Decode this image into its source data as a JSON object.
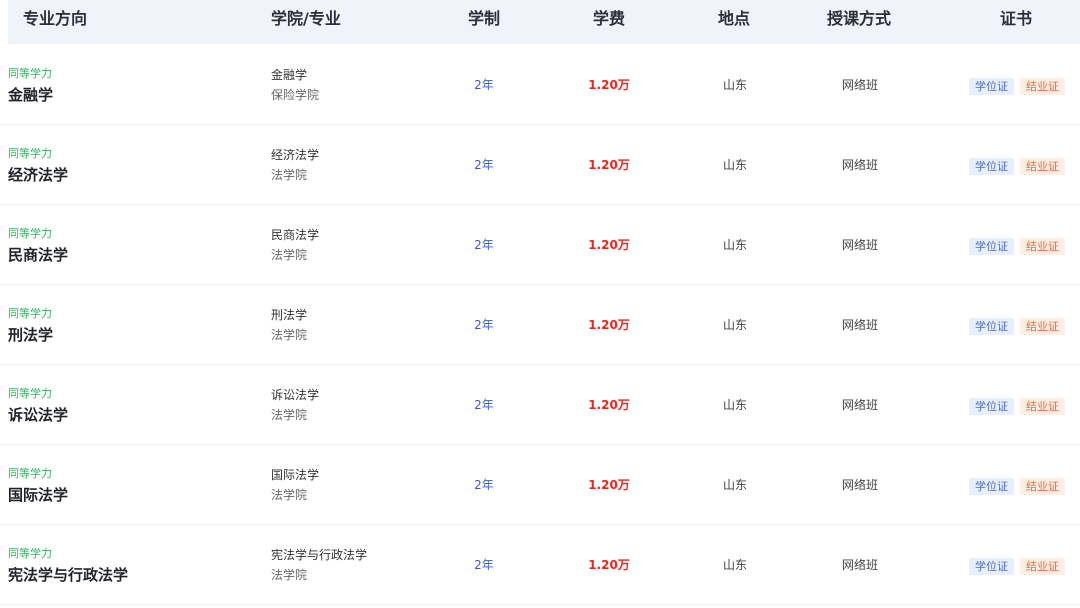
{
  "header": {
    "col_direction": "专业方向",
    "col_college": "学院/专业",
    "col_duration": "学制",
    "col_fee": "学费",
    "col_location": "地点",
    "col_mode": "授课方式",
    "col_certificate": "证书"
  },
  "rows": [
    {
      "type": "同等学力",
      "name": "金融学",
      "sub_major": "金融学",
      "college": "保险学院",
      "duration": "2年",
      "fee": "1.20万",
      "location": "山东",
      "mode": "网络班",
      "cert_degree": "学位证",
      "cert_grad": "结业证"
    },
    {
      "type": "同等学力",
      "name": "经济法学",
      "sub_major": "经济法学",
      "college": "法学院",
      "duration": "2年",
      "fee": "1.20万",
      "location": "山东",
      "mode": "网络班",
      "cert_degree": "学位证",
      "cert_grad": "结业证"
    },
    {
      "type": "同等学力",
      "name": "民商法学",
      "sub_major": "民商法学",
      "college": "法学院",
      "duration": "2年",
      "fee": "1.20万",
      "location": "山东",
      "mode": "网络班",
      "cert_degree": "学位证",
      "cert_grad": "结业证"
    },
    {
      "type": "同等学力",
      "name": "刑法学",
      "sub_major": "刑法学",
      "college": "法学院",
      "duration": "2年",
      "fee": "1.20万",
      "location": "山东",
      "mode": "网络班",
      "cert_degree": "学位证",
      "cert_grad": "结业证"
    },
    {
      "type": "同等学力",
      "name": "诉讼法学",
      "sub_major": "诉讼法学",
      "college": "法学院",
      "duration": "2年",
      "fee": "1.20万",
      "location": "山东",
      "mode": "网络班",
      "cert_degree": "学位证",
      "cert_grad": "结业证"
    },
    {
      "type": "同等学力",
      "name": "国际法学",
      "sub_major": "国际法学",
      "college": "法学院",
      "duration": "2年",
      "fee": "1.20万",
      "location": "山东",
      "mode": "网络班",
      "cert_degree": "学位证",
      "cert_grad": "结业证"
    },
    {
      "type": "同等学力",
      "name": "宪法学与行政法学",
      "sub_major": "宪法学与行政法学",
      "college": "法学院",
      "duration": "2年",
      "fee": "1.20万",
      "location": "山东",
      "mode": "网络班",
      "cert_degree": "学位证",
      "cert_grad": "结业证"
    }
  ],
  "colors": {
    "header_bg": "#f0f3f9",
    "type_green": "#2db55d",
    "duration_blue": "#3a63c8",
    "fee_red": "#e8261c",
    "badge_degree_bg": "#e8eefc",
    "badge_grad_bg": "#fdeee6"
  }
}
